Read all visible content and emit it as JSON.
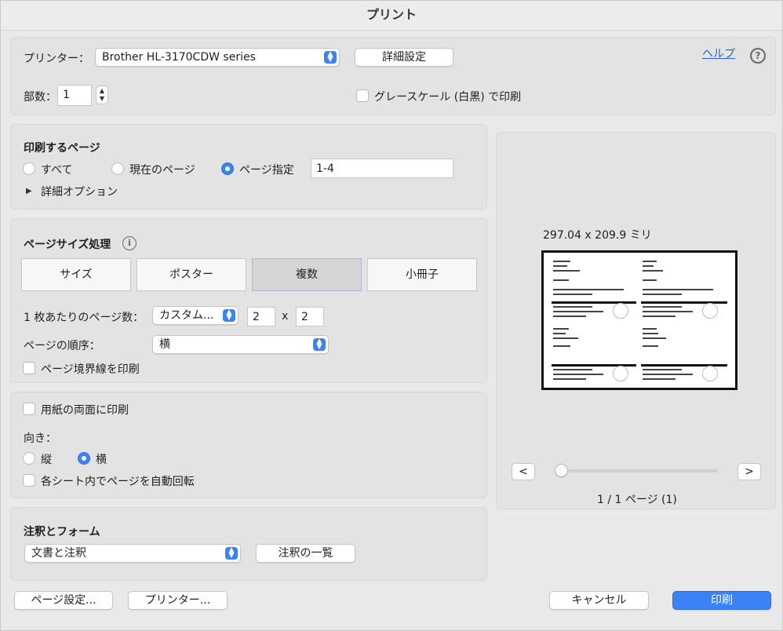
{
  "window": {
    "title": "プリント"
  },
  "top": {
    "printer_label": "プリンター：",
    "printer_value": "Brother HL-3170CDW series",
    "details_button": "詳細設定",
    "help_link": "ヘルプ",
    "help_icon_glyph": "?",
    "copies_label": "部数：",
    "copies_value": "1",
    "grayscale_label": "グレースケール (白黒) で印刷",
    "grayscale_checked": false
  },
  "pages_section": {
    "title": "印刷するページ",
    "options": [
      {
        "label": "すべて",
        "selected": false
      },
      {
        "label": "現在のページ",
        "selected": false
      },
      {
        "label": "ページ指定",
        "selected": true
      }
    ],
    "range_value": "1-4",
    "detail_options": "詳細オプション"
  },
  "page_size_section": {
    "title": "ページサイズ処理",
    "info_glyph": "i",
    "segments": [
      {
        "label": "サイズ",
        "selected": false
      },
      {
        "label": "ポスター",
        "selected": false
      },
      {
        "label": "複数",
        "selected": true
      },
      {
        "label": "小冊子",
        "selected": false
      }
    ],
    "pages_per_sheet_label": "1 枚あたりのページ数：",
    "pages_per_sheet_value": "カスタム...",
    "grid_cols": "2",
    "grid_x": "x",
    "grid_rows": "2",
    "order_label": "ページの順序：",
    "order_value": "横",
    "border_label": "ページ境界線を印刷",
    "border_checked": false
  },
  "duplex_section": {
    "duplex_label": "用紙の両面に印刷",
    "duplex_checked": false,
    "orientation_label": "向き：",
    "orientation_options": [
      {
        "label": "縦",
        "selected": false
      },
      {
        "label": "横",
        "selected": true
      }
    ],
    "auto_rotate_label": "各シート内でページを自動回転",
    "auto_rotate_checked": false
  },
  "annotations_section": {
    "title": "注釈とフォーム",
    "popup_value": "文書と注釈",
    "list_button": "注釈の一覧"
  },
  "preview": {
    "size_text": "297.04 x 209.9 ミリ",
    "prev_glyph": "<",
    "next_glyph": ">",
    "page_status": "1 / 1 ページ (1)",
    "slider_position": 0
  },
  "bottom": {
    "page_setup_button": "ページ設定...",
    "printer_button": "プリンター...",
    "cancel_button": "キャンセル",
    "print_button": "印刷"
  },
  "colors": {
    "accent": "#3b82f6",
    "link": "#2a62c9",
    "panel": "#e3e3e3",
    "window": "#e9e9e9"
  }
}
